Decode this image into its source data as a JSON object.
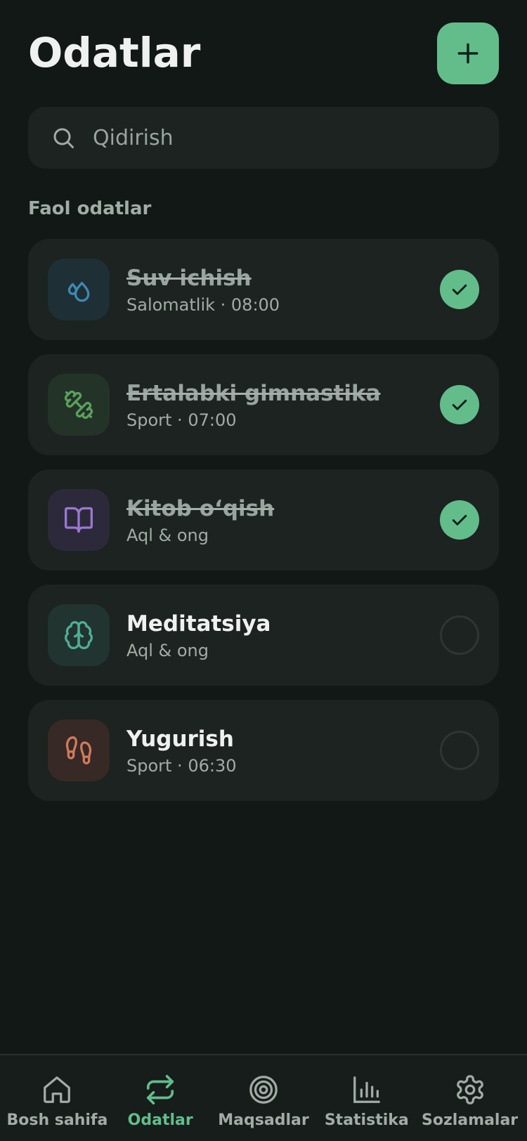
{
  "header": {
    "title": "Odatlar",
    "add_button_icon": "plus-icon"
  },
  "search": {
    "placeholder": "Qidirish",
    "value": ""
  },
  "section": {
    "title": "Faol odatlar"
  },
  "habits": [
    {
      "name": "Suv ichish",
      "meta": "Salomatlik · 08:00",
      "icon": "water-drops-icon",
      "done": true,
      "color": "#3f89b2",
      "bg": "#1e2f35"
    },
    {
      "name": "Ertalabki gimnastika",
      "meta": "Sport · 07:00",
      "icon": "dumbbell-icon",
      "done": true,
      "color": "#5ba15d",
      "bg": "#243328"
    },
    {
      "name": "Kitob o‘qish",
      "meta": "Aql & ong",
      "icon": "book-icon",
      "done": true,
      "color": "#9b78d2",
      "bg": "#2c2a3a"
    },
    {
      "name": "Meditatsiya",
      "meta": "Aql & ong",
      "icon": "brain-icon",
      "done": false,
      "color": "#4fae95",
      "bg": "#22342f"
    },
    {
      "name": "Yugurish",
      "meta": "Sport · 06:30",
      "icon": "footprints-icon",
      "done": false,
      "color": "#d07a5c",
      "bg": "#372925"
    }
  ],
  "nav": {
    "items": [
      {
        "label": "Bosh sahifa",
        "icon": "home-icon",
        "active": false
      },
      {
        "label": "Odatlar",
        "icon": "repeat-icon",
        "active": true
      },
      {
        "label": "Maqsadlar",
        "icon": "target-icon",
        "active": false
      },
      {
        "label": "Statistika",
        "icon": "bar-chart-icon",
        "active": false
      },
      {
        "label": "Sozlamalar",
        "icon": "gear-icon",
        "active": false
      }
    ]
  },
  "colors": {
    "accent": "#62bd8b",
    "background": "#111816",
    "card": "#1c2320",
    "text_muted": "#a3aba7"
  }
}
